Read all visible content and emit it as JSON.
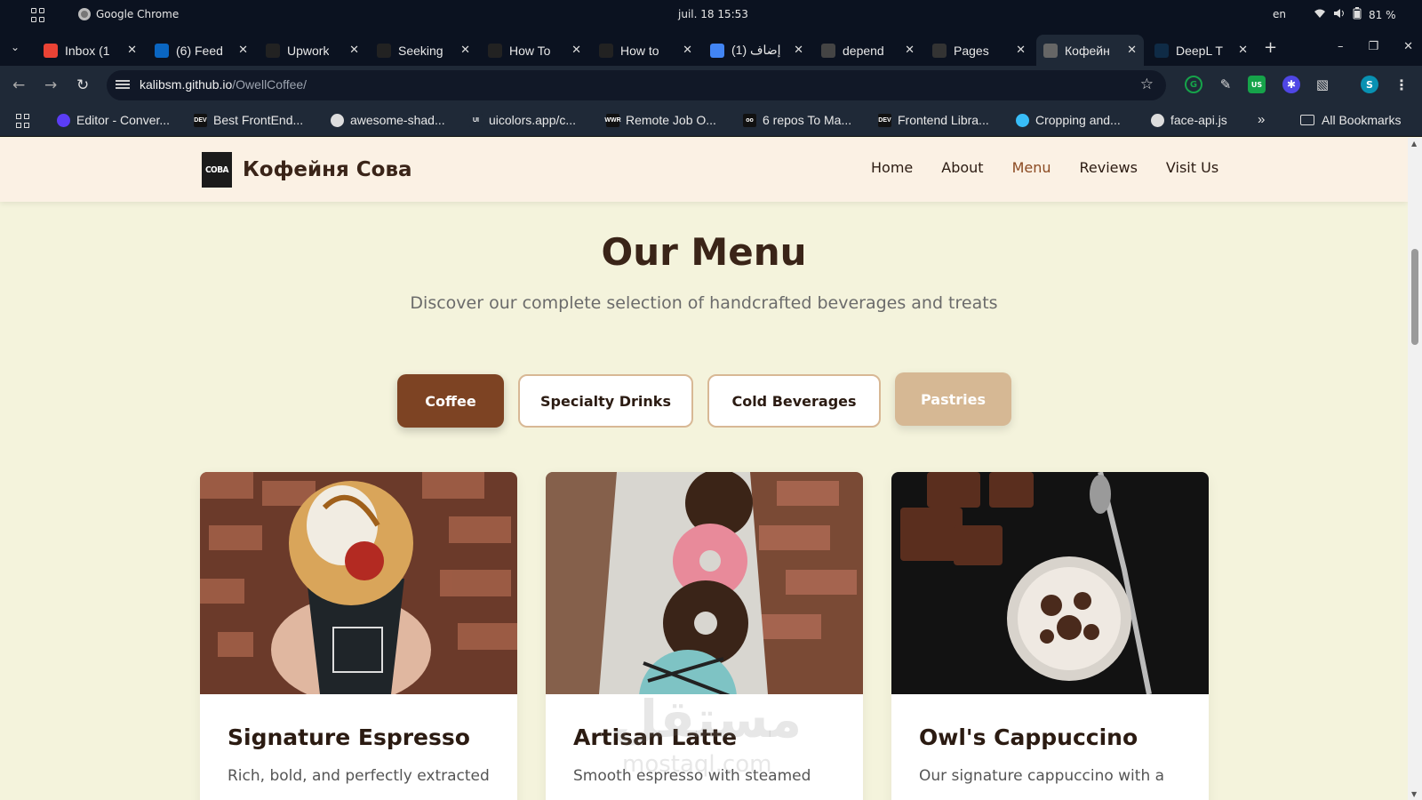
{
  "os": {
    "app_name": "Google Chrome",
    "clock": "juil. 18  15:53",
    "lang": "en",
    "battery": "81 %"
  },
  "tabs": [
    {
      "title": "Inbox (1",
      "icon": "gmail-icon",
      "color": "#ea4335"
    },
    {
      "title": "(6) Feed",
      "icon": "linkedin-icon",
      "color": "#0a66c2"
    },
    {
      "title": "Upwork",
      "icon": "upwork-icon",
      "color": "#222"
    },
    {
      "title": "Seeking",
      "icon": "upwork-icon",
      "color": "#222"
    },
    {
      "title": "How To",
      "icon": "upwork-icon",
      "color": "#222"
    },
    {
      "title": "How to",
      "icon": "upwork-icon",
      "color": "#222"
    },
    {
      "title": "إضاف (1)",
      "icon": "google-icon",
      "color": "#4285f4"
    },
    {
      "title": "depend",
      "icon": "openai-icon",
      "color": "#444"
    },
    {
      "title": "Pages",
      "icon": "github-icon",
      "color": "#333"
    },
    {
      "title": "Кофейн",
      "icon": "globe-icon",
      "color": "#666"
    },
    {
      "title": "DeepL T",
      "icon": "deepl-icon",
      "color": "#0f2b46"
    }
  ],
  "omnibox": {
    "host": "kalibsm.github.io",
    "path": "/OwellCoffee/"
  },
  "bookmarks": [
    {
      "label": "Editor - Conver...",
      "color": "#5b3df5"
    },
    {
      "label": "Best FrontEnd...",
      "color": "#111",
      "badge": "DEV"
    },
    {
      "label": "awesome-shad...",
      "color": "#ddd"
    },
    {
      "label": "uicolors.app/c...",
      "color": "#1f2937",
      "badge": "UI"
    },
    {
      "label": "Remote Job O...",
      "color": "#111",
      "badge": "WWR"
    },
    {
      "label": "6 repos To Ma...",
      "color": "#111",
      "badge": "oo"
    },
    {
      "label": "Frontend Libra...",
      "color": "#111",
      "badge": "DEV"
    },
    {
      "label": "Cropping and...",
      "color": "#38bdf8"
    },
    {
      "label": "face-api.js",
      "color": "#ddd"
    }
  ],
  "bookmarks_all": "All Bookmarks",
  "site": {
    "brand_logo": "СОВА",
    "brand_name": "Кофейня Сова",
    "nav": [
      "Home",
      "About",
      "Menu",
      "Reviews",
      "Visit Us"
    ],
    "nav_active": "Menu"
  },
  "menu": {
    "title": "Our Menu",
    "subtitle": "Discover our complete selection of handcrafted beverages and treats",
    "filters": [
      "Coffee",
      "Specialty Drinks",
      "Cold Beverages",
      "Pastries"
    ],
    "active_filter": "Coffee",
    "items": [
      {
        "name": "Signature Espresso",
        "desc": "Rich, bold, and perfectly extracted"
      },
      {
        "name": "Artisan Latte",
        "desc": "Smooth espresso with steamed"
      },
      {
        "name": "Owl's Cappuccino",
        "desc": "Our signature cappuccino with a"
      }
    ]
  },
  "watermark": {
    "arabic": "مستقل",
    "latin": "mostaql.com"
  }
}
